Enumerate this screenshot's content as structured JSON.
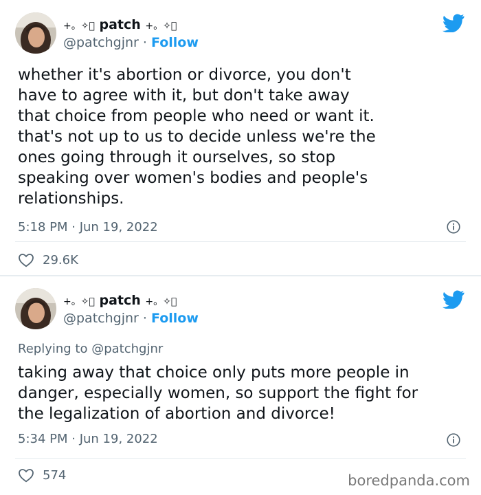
{
  "tweets": [
    {
      "display_name": "patch",
      "name_prefix_symbols": "+。✧⃝",
      "name_suffix_symbols": "+。✧⃝",
      "handle": "@patchgjnr",
      "separator": "·",
      "follow_label": "Follow",
      "replying_to": "",
      "text": "whether it's abortion or divorce, you don't\nhave to agree with it, but don't take away\nthat choice from people who need or want it.\nthat's not up to us to decide unless we're the\nones going through it ourselves, so stop\nspeaking over women's bodies and people's\nrelationships.",
      "timestamp": "5:18 PM · Jun 19, 2022",
      "likes": "29.6K"
    },
    {
      "display_name": "patch",
      "name_prefix_symbols": "+。✧⃝",
      "name_suffix_symbols": "+。✧⃝",
      "handle": "@patchgjnr",
      "separator": "·",
      "follow_label": "Follow",
      "replying_to": "Replying to @patchgjnr",
      "text": "taking away that choice only puts more people in\ndanger, especially women, so support the fight for\nthe legalization of abortion and divorce!",
      "timestamp": "5:34 PM · Jun 19, 2022",
      "likes": "574"
    }
  ],
  "watermark": "boredpanda.com",
  "colors": {
    "twitter_blue": "#1d9bf0",
    "secondary_text": "#536471",
    "primary_text": "#0f1419"
  },
  "icons": [
    "avatar",
    "twitter-bird-icon",
    "info-icon",
    "heart-icon"
  ]
}
